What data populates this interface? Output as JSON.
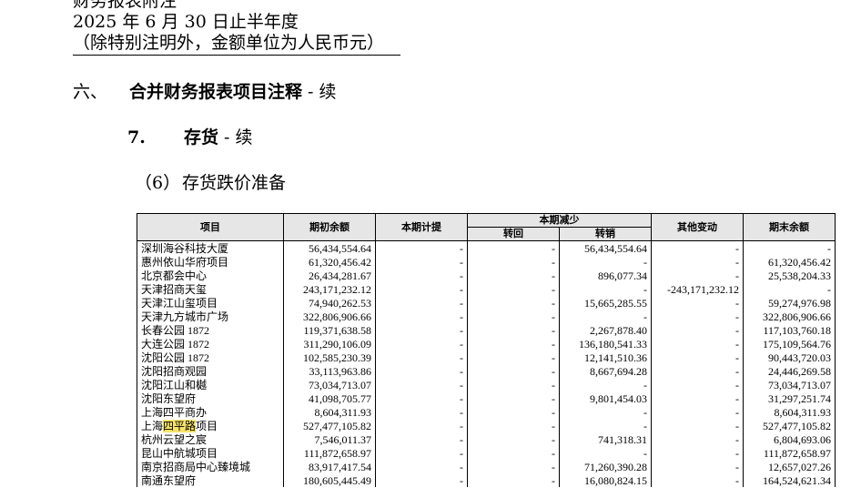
{
  "header": {
    "line1": "财务报表附注",
    "line2": "2025 年 6 月 30 日止半年度",
    "line3": "（除特别注明外，金额单位为人民币元）"
  },
  "section": {
    "num": "六、",
    "title": "合并财务报表项目注释",
    "suffix": " - 续"
  },
  "subsection": {
    "num": "7.",
    "title": "存货",
    "suffix": " - 续"
  },
  "subsubsection": {
    "num": "（6）",
    "title": "存货跌价准备"
  },
  "table": {
    "headers": {
      "item": "项目",
      "opening": "期初余额",
      "provision": "本期计提",
      "decrease": "本期减少",
      "reversal": "转回",
      "transfer": "转销",
      "other": "其他变动",
      "closing": "期末余额"
    },
    "rows": [
      {
        "name": "深圳海谷科技大厦",
        "opening": "56,434,554.64",
        "provision": "-",
        "reversal": "-",
        "transfer": "56,434,554.64",
        "other": "-",
        "closing": "-"
      },
      {
        "name": "惠州依山华府项目",
        "opening": "61,320,456.42",
        "provision": "-",
        "reversal": "-",
        "transfer": "-",
        "other": "-",
        "closing": "61,320,456.42"
      },
      {
        "name": "北京都会中心",
        "opening": "26,434,281.67",
        "provision": "-",
        "reversal": "-",
        "transfer": "896,077.34",
        "other": "-",
        "closing": "25,538,204.33"
      },
      {
        "name": "天津招商天玺",
        "opening": "243,171,232.12",
        "provision": "-",
        "reversal": "-",
        "transfer": "-",
        "other": "-243,171,232.12",
        "closing": "-"
      },
      {
        "name": "天津江山玺项目",
        "opening": "74,940,262.53",
        "provision": "-",
        "reversal": "-",
        "transfer": "15,665,285.55",
        "other": "-",
        "closing": "59,274,976.98"
      },
      {
        "name": "天津九方城市广场",
        "opening": "322,806,906.66",
        "provision": "-",
        "reversal": "-",
        "transfer": "-",
        "other": "-",
        "closing": "322,806,906.66"
      },
      {
        "name": "长春公园 1872",
        "opening": "119,371,638.58",
        "provision": "-",
        "reversal": "-",
        "transfer": "2,267,878.40",
        "other": "-",
        "closing": "117,103,760.18"
      },
      {
        "name": "大连公园 1872",
        "opening": "311,290,106.09",
        "provision": "-",
        "reversal": "-",
        "transfer": "136,180,541.33",
        "other": "-",
        "closing": "175,109,564.76"
      },
      {
        "name": "沈阳公园 1872",
        "opening": "102,585,230.39",
        "provision": "-",
        "reversal": "-",
        "transfer": "12,141,510.36",
        "other": "-",
        "closing": "90,443,720.03"
      },
      {
        "name": "沈阳招商观园",
        "opening": "33,113,963.86",
        "provision": "-",
        "reversal": "-",
        "transfer": "8,667,694.28",
        "other": "-",
        "closing": "24,446,269.58"
      },
      {
        "name": "沈阳江山和樾",
        "opening": "73,034,713.07",
        "provision": "-",
        "reversal": "-",
        "transfer": "-",
        "other": "-",
        "closing": "73,034,713.07"
      },
      {
        "name": "沈阳东望府",
        "opening": "41,098,705.77",
        "provision": "-",
        "reversal": "-",
        "transfer": "9,801,454.03",
        "other": "-",
        "closing": "31,297,251.74"
      },
      {
        "name": "上海四平商办",
        "opening": "8,604,311.93",
        "provision": "-",
        "reversal": "-",
        "transfer": "-",
        "other": "-",
        "closing": "8,604,311.93"
      },
      {
        "name_pre": "上海",
        "name_hl": "四平路",
        "name_post": "项目",
        "opening": "527,477,105.82",
        "provision": "-",
        "reversal": "-",
        "transfer": "-",
        "other": "-",
        "closing": "527,477,105.82"
      },
      {
        "name": "杭州云望之宸",
        "opening": "7,546,011.37",
        "provision": "-",
        "reversal": "-",
        "transfer": "741,318.31",
        "other": "-",
        "closing": "6,804,693.06"
      },
      {
        "name": "昆山中航城项目",
        "opening": "111,872,658.97",
        "provision": "-",
        "reversal": "-",
        "transfer": "-",
        "other": "-",
        "closing": "111,872,658.97"
      },
      {
        "name": "南京招商局中心臻境城",
        "opening": "83,917,417.54",
        "provision": "-",
        "reversal": "-",
        "transfer": "71,260,390.28",
        "other": "-",
        "closing": "12,657,027.26"
      },
      {
        "name": "南通东望府",
        "opening": "180,605,445.49",
        "provision": "-",
        "reversal": "-",
        "transfer": "16,080,824.15",
        "other": "-",
        "closing": "164,524,621.34"
      }
    ]
  }
}
